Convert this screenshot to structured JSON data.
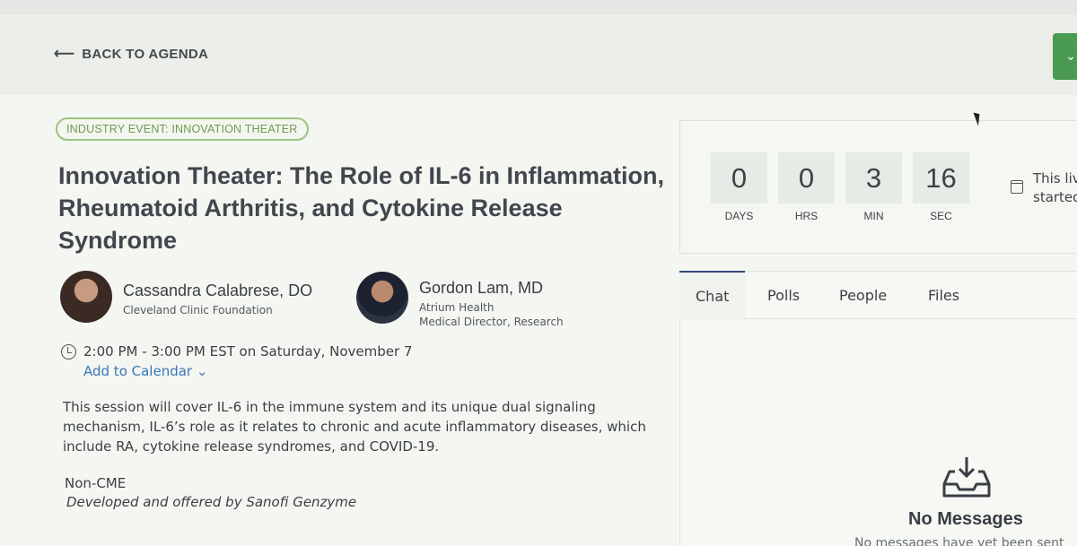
{
  "header": {
    "back_label": "BACK TO AGENDA",
    "back_icon": "arrow-left-icon",
    "menu_icon": "chevron-down-icon"
  },
  "session": {
    "tag": "INDUSTRY EVENT: INNOVATION THEATER",
    "title": "Innovation Theater: The Role of IL-6 in Inflammation, Rheumatoid Arthritis, and Cytokine Release Syndrome",
    "speakers": [
      {
        "name": "Cassandra Calabrese, DO",
        "org": "Cleveland Clinic Foundation",
        "role": ""
      },
      {
        "name": "Gordon Lam, MD",
        "org": "Atrium Health",
        "role": "Medical Director, Research"
      }
    ],
    "when": "2:00 PM - 3:00 PM EST on Saturday, November 7",
    "add_to_calendar": "Add to Calendar",
    "description": "This session will cover IL-6 in the immune system and its unique dual signaling mechanism, IL-6’s role as it relates to chronic and acute inflammatory diseases, which include RA, cytokine release syndromes, and COVID-19.",
    "credit": "Non-CME",
    "sponsor": "Developed and offered by Sanofi Genzyme"
  },
  "countdown": {
    "days": {
      "value": "0",
      "label": "DAYS"
    },
    "hours": {
      "value": "0",
      "label": "HRS"
    },
    "minutes": {
      "value": "3",
      "label": "MIN"
    },
    "seconds": {
      "value": "16",
      "label": "SEC"
    },
    "status_text_line1": "This liv",
    "status_text_line2": "started"
  },
  "panel": {
    "tabs": [
      "Chat",
      "Polls",
      "People",
      "Files"
    ],
    "active_tab": "Chat",
    "empty_title": "No Messages",
    "empty_subtitle": "No messages have yet been sent"
  },
  "colors": {
    "accent_green": "#4a9a52",
    "tag_green": "#6f9a52",
    "link_blue": "#3a78b5",
    "active_tab_border": "#2f4a7a"
  }
}
